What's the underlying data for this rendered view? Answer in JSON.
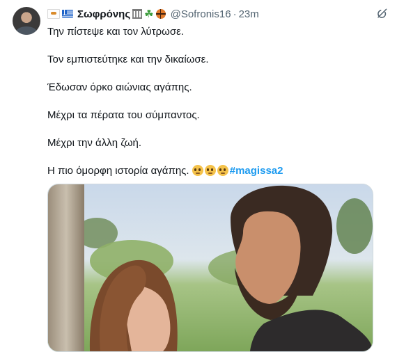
{
  "author": {
    "name": "Σωφρόνης",
    "handle": "@Sofronis16",
    "separator": "·",
    "time": "23m",
    "badges": [
      "cyprus-flag-icon",
      "greece-flag-icon",
      "classical-building-icon",
      "shamrock-icon",
      "basketball-icon"
    ]
  },
  "tweet": {
    "lines": [
      "Την πίστεψε και τον λύτρωσε.",
      "Τον εμπιστεύτηκε και την δικαίωσε.",
      "Έδωσαν όρκο αιώνιας αγάπης.",
      "Μέχρι τα πέρατα του σύμπαντος.",
      "Μέχρι την άλλη ζωή."
    ],
    "last_line_text": "Η πιο όμορφη ιστορία αγάπης.",
    "emoji_icon": "pleading-face-icon",
    "hashtag": "#magissa2"
  },
  "colors": {
    "text": "#0f1419",
    "secondary": "#536471",
    "link": "#1d9bf0"
  }
}
